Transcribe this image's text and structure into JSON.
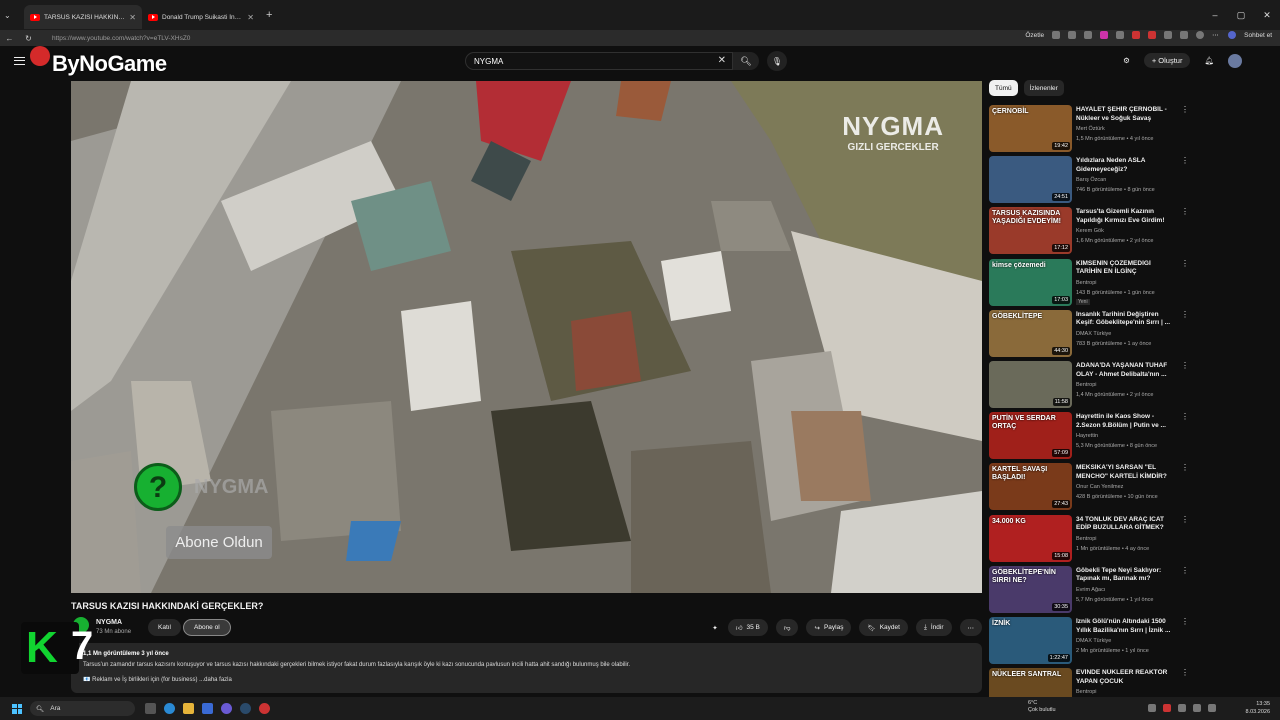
{
  "browser": {
    "tabs": [
      {
        "label": "TARSUS KAZISI HAKKINDAKİ GERÇEKLER?",
        "active": true
      },
      {
        "label": "Donald Trump Suikasti İnanılmaz Detaylar",
        "active": false
      }
    ],
    "new_tab": "+",
    "url": "https://www.youtube.com/watch?v=eTLV-XHsZ0",
    "ozetle_label": "Özetle",
    "sohbet_label": "Sohbet et",
    "window_controls": [
      "–",
      "▢",
      "✕"
    ]
  },
  "youtube": {
    "logo_overlay": "ByNoGame",
    "search_value": "NYGMA",
    "create_label": "Oluştur"
  },
  "player": {
    "watermark_main": "NYGMA",
    "watermark_sub": "GIZLI GERCEKLER",
    "channel_watermark": "NYGMA",
    "subscribed_overlay": "Abone Oldun",
    "q_mark": "?"
  },
  "video": {
    "title": "TARSUS KAZISI HAKKINDAKİ GERÇEKLER?",
    "channel": "NYGMA",
    "subscribers": "73 Mn abone",
    "join_label": "Katıl",
    "subscribe_label": "Abone ol",
    "likes": "35 B",
    "share_label": "Paylaş",
    "save_label": "Kaydet",
    "download_label": "İndir",
    "more": "⋯",
    "desc_meta": "1,1 Mn görüntüleme  3 yıl önce",
    "desc_text": "Tarsus'un zamandır tarsus kazısını konuşuyor ve tarsus kazısı hakkındaki gerçekleri bilmek istiyor fakat durum fazlasıyla karışık öyle ki kazı sonucunda pavlusun incili hatta ahit sandığı bulunmuş bile olabilir.",
    "desc_line2": "📧 Reklam ve İş birlikleri için (for business) ...daha fazla"
  },
  "overlay_badge": {
    "k": "K",
    "n": "7"
  },
  "sidebar": {
    "chips": [
      "Tümü",
      "İzlenenler"
    ],
    "items": [
      {
        "thumb_text": "ÇERNOBİL",
        "duration": "19:42",
        "title": "HAYALET ŞEHİR ÇERNOBİL - Nükleer ve Soğuk Savaş",
        "channel": "Mert Öztürk",
        "meta": "1,5 Mn görüntüleme • 4 yıl önce",
        "color": "#8a5a2a"
      },
      {
        "thumb_text": "",
        "duration": "24:51",
        "title": "Yıldızlara Neden ASLA Gidemeyeceğiz?",
        "channel": "Barış Özcan",
        "meta": "746 B görüntüleme • 8 gün önce",
        "color": "#3a5a80"
      },
      {
        "thumb_text": "TARSUS KAZISINDA YAŞADIĞI EVDEYİM!",
        "duration": "17:12",
        "title": "Tarsus'ta Gizemli Kazının Yapıldığı Kırmızı Eve Girdim!",
        "channel": "Kerem Gök",
        "meta": "1,6 Mn görüntüleme • 2 yıl önce",
        "color": "#9a3a2a"
      },
      {
        "thumb_text": "kimse çözemedi",
        "duration": "17:03",
        "title": "KİMSENİN ÇÖZEMEDİĞİ TARİHİN EN İLGİNÇ KAYBOLM...",
        "channel": "Bentropi",
        "meta": "143 B görüntüleme • 1 gün önce",
        "new": "Yeni",
        "color": "#2a7a5a"
      },
      {
        "thumb_text": "GÖBEKLİTEPE",
        "duration": "44:30",
        "title": "İnsanlık Tarihini Değiştiren Keşif: Göbeklitepe'nin Sırrı | ...",
        "channel": "DMAX Türkiye",
        "meta": "783 B görüntüleme • 1 ay önce",
        "color": "#8a6a3a"
      },
      {
        "thumb_text": "",
        "duration": "11:58",
        "title": "ADANA'DA YAŞANAN TUHAF OLAY - Ahmet Delibalta'nın ...",
        "channel": "Bentropi",
        "meta": "1,4 Mn görüntüleme • 2 yıl önce",
        "color": "#6a6a5a"
      },
      {
        "thumb_text": "PUTİN VE SERDAR ORTAÇ",
        "duration": "57:09",
        "title": "Hayrettin ile Kaos Show - 2.Sezon 9.Bölüm | Putin ve ...",
        "channel": "Hayrettin",
        "meta": "5,3 Mn görüntüleme • 8 gün önce",
        "color": "#a0201a"
      },
      {
        "thumb_text": "KARTEL SAVAŞI BAŞLADI!",
        "duration": "27:43",
        "title": "MEKSİKA'YI SARSAN \"EL MENCHO\" KARTELİ KİMDİR?",
        "channel": "Onur Can Yenilmez",
        "meta": "428 B görüntüleme • 10 gün önce",
        "color": "#7a3a1a"
      },
      {
        "thumb_text": "34.000 KG",
        "duration": "15:08",
        "title": "34 TONLUK DEV ARAÇ İCAT EDİP BUZULLARA GİTMEK?",
        "channel": "Bentropi",
        "meta": "1 Mn görüntüleme • 4 ay önce",
        "color": "#b02020"
      },
      {
        "thumb_text": "GÖBEKLİTEPE'NİN SIRRI NE?",
        "duration": "30:35",
        "title": "Göbekli Tepe Neyi Saklıyor: Tapınak mı, Barınak mı?",
        "channel": "Evrim Ağacı",
        "meta": "5,7 Mn görüntüleme • 1 yıl önce",
        "color": "#4a3a6a"
      },
      {
        "thumb_text": "İZNİK",
        "duration": "1:22:47",
        "title": "İznik Gölü'nün Altındaki 1500 Yıllık Bazilika'nın Sırrı | İznik ...",
        "channel": "DMAX Türkiye",
        "meta": "2 Mn görüntüleme • 1 yıl önce",
        "color": "#2a5a7a"
      },
      {
        "thumb_text": "NÜKLEER SANTRAL",
        "duration": "",
        "title": "EVİNDE NÜKLEER REAKTÖR YAPAN ÇOCUK",
        "channel": "Bentropi",
        "meta": "",
        "color": "#6a4a20"
      }
    ]
  },
  "taskbar": {
    "search_placeholder": "Ara",
    "weather_temp": "6°C",
    "weather_desc": "Çok bulutlu",
    "time": "13:35",
    "date": "8.03.2026"
  }
}
